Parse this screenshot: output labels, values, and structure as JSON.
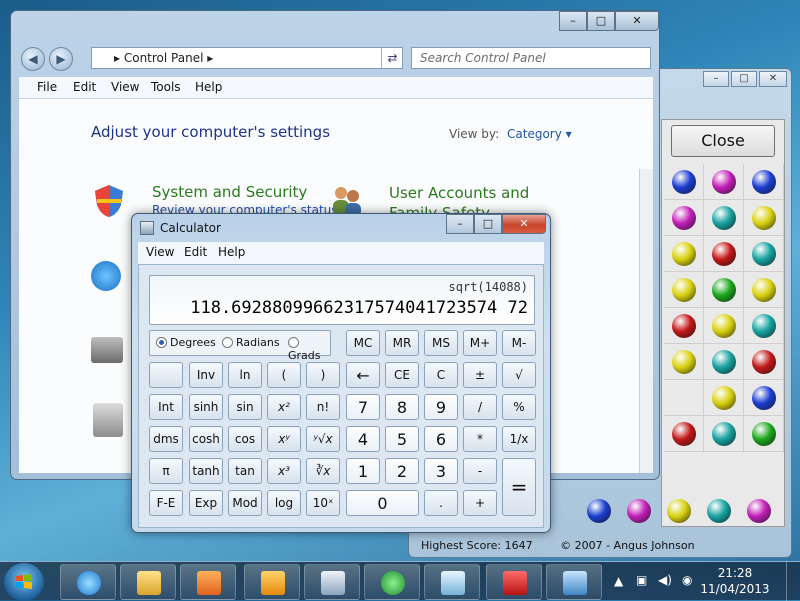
{
  "control_panel": {
    "address": "Control Panel",
    "search_placeholder": "Search Control Panel",
    "menu": [
      "File",
      "Edit",
      "View",
      "Tools",
      "Help"
    ],
    "heading": "Adjust your computer's settings",
    "view_by_label": "View by:",
    "view_by_value": "Category",
    "categories": [
      {
        "title": "System and Security",
        "subtitle": "Review your computer's status"
      },
      {
        "title": "User Accounts and Family Safety",
        "subtitle": ""
      }
    ]
  },
  "calculator": {
    "title": "Calculator",
    "menu": [
      "View",
      "Edit",
      "Help"
    ],
    "expression": "sqrt(14088)",
    "value": "118.69288099662317574041723574 72",
    "angle_modes": [
      "Degrees",
      "Radians",
      "Grads"
    ],
    "selected_angle": "Degrees",
    "memory_keys": [
      "MC",
      "MR",
      "MS",
      "M+",
      "M-"
    ],
    "rows": [
      [
        "",
        "Inv",
        "ln",
        "(",
        ")",
        "←",
        "CE",
        "C",
        "±",
        "√"
      ],
      [
        "Int",
        "sinh",
        "sin",
        "x²",
        "n!",
        "7",
        "8",
        "9",
        "/",
        "%"
      ],
      [
        "dms",
        "cosh",
        "cos",
        "xʸ",
        "ʸ√x",
        "4",
        "5",
        "6",
        "*",
        "1/x"
      ],
      [
        "π",
        "tanh",
        "tan",
        "x³",
        "∛x",
        "1",
        "2",
        "3",
        "-",
        "="
      ],
      [
        "F-E",
        "Exp",
        "Mod",
        "log",
        "10ˣ",
        "0",
        ".",
        "+"
      ]
    ]
  },
  "game": {
    "close_label": "Close",
    "high_score": "Highest Score: 1647",
    "copyright": "© 2007 - Angus Johnson",
    "colors": {
      "blue": "#1b3fd1",
      "magenta": "#c21fb8",
      "teal": "#17a3a1",
      "yellow": "#d8d20f",
      "red": "#c41818",
      "green": "#1ca81c"
    },
    "grid": [
      [
        "blue",
        "magenta",
        "blue"
      ],
      [
        "magenta",
        "teal",
        "yellow"
      ],
      [
        "yellow",
        "red",
        "teal"
      ],
      [
        "yellow",
        "green",
        "yellow"
      ],
      [
        "red",
        "yellow",
        "teal"
      ],
      [
        "yellow",
        "teal",
        "red"
      ],
      [
        "",
        "yellow",
        "blue"
      ],
      [
        "red",
        "teal",
        "green"
      ]
    ],
    "bottom_row": [
      "blue",
      "magenta",
      "yellow",
      "teal",
      "magenta"
    ]
  },
  "taskbar": {
    "time": "21:28",
    "date": "11/04/2013",
    "apps": [
      "internet-explorer",
      "file-explorer",
      "media-player",
      "outlook",
      "calculator",
      "messenger",
      "notes",
      "psp",
      "remote-desktop"
    ]
  }
}
